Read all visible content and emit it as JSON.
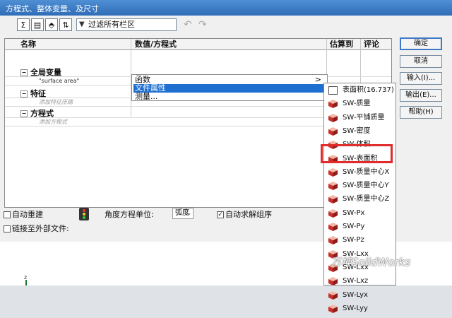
{
  "window": {
    "title": "方程式、整体变量、及尺寸"
  },
  "toolbar": {
    "icons": [
      "sigma-icon",
      "sheet-icon",
      "dims-icon",
      "sort-icon"
    ],
    "filter_text": "过滤所有栏区",
    "filter_icon": "funnel-icon",
    "undo_icon": "undo-icon",
    "redo_icon": "redo-icon"
  },
  "grid": {
    "headers": [
      "名称",
      "数值/方程式",
      "估算到",
      "评论"
    ],
    "rows": [
      {
        "type": "group",
        "name": "全局变量"
      },
      {
        "type": "item",
        "name": "\"surface area\"",
        "value": ""
      },
      {
        "type": "group",
        "name": "特征"
      },
      {
        "type": "placeholder",
        "name": "添加特征压缩"
      },
      {
        "type": "group",
        "name": "方程式"
      },
      {
        "type": "placeholder",
        "name": "添加方程式"
      }
    ]
  },
  "menu": {
    "items": [
      {
        "label": "函数",
        "arrow": ">"
      },
      {
        "label": "文件属性",
        "selected": true
      },
      {
        "label": "测量..."
      }
    ]
  },
  "submenu": {
    "items": [
      "表面积(16.737)",
      "SW-质量",
      "SW-平铺质量",
      "SW-密度",
      "SW-体积",
      "SW-表面积",
      "SW-质量中心X",
      "SW-质量中心Y",
      "SW-质量中心Z",
      "SW-Px",
      "SW-Py",
      "SW-Pz",
      "SW-Lxx",
      "SW-Lxx",
      "SW-Lxz",
      "SW-Lyx",
      "SW-Lyy"
    ],
    "highlighted": "SW-表面积"
  },
  "buttons": {
    "ok": "确定",
    "cancel": "取消",
    "import": "输入(I)...",
    "export": "输出(E)...",
    "help": "帮助(H)"
  },
  "options": {
    "auto_rebuild": "自动重建",
    "link_external": "链接至外部文件:",
    "angle_unit_label": "角度方程单位:",
    "angle_unit_value": "弧度",
    "auto_solve": "自动求解组序"
  },
  "colors": {
    "accent": "#1f6fd0",
    "highlight": "#e12b2b",
    "titlebar": "#2f6db8"
  },
  "watermark": "万坤SolidWorks",
  "viewport": {
    "axis_label": "z"
  }
}
